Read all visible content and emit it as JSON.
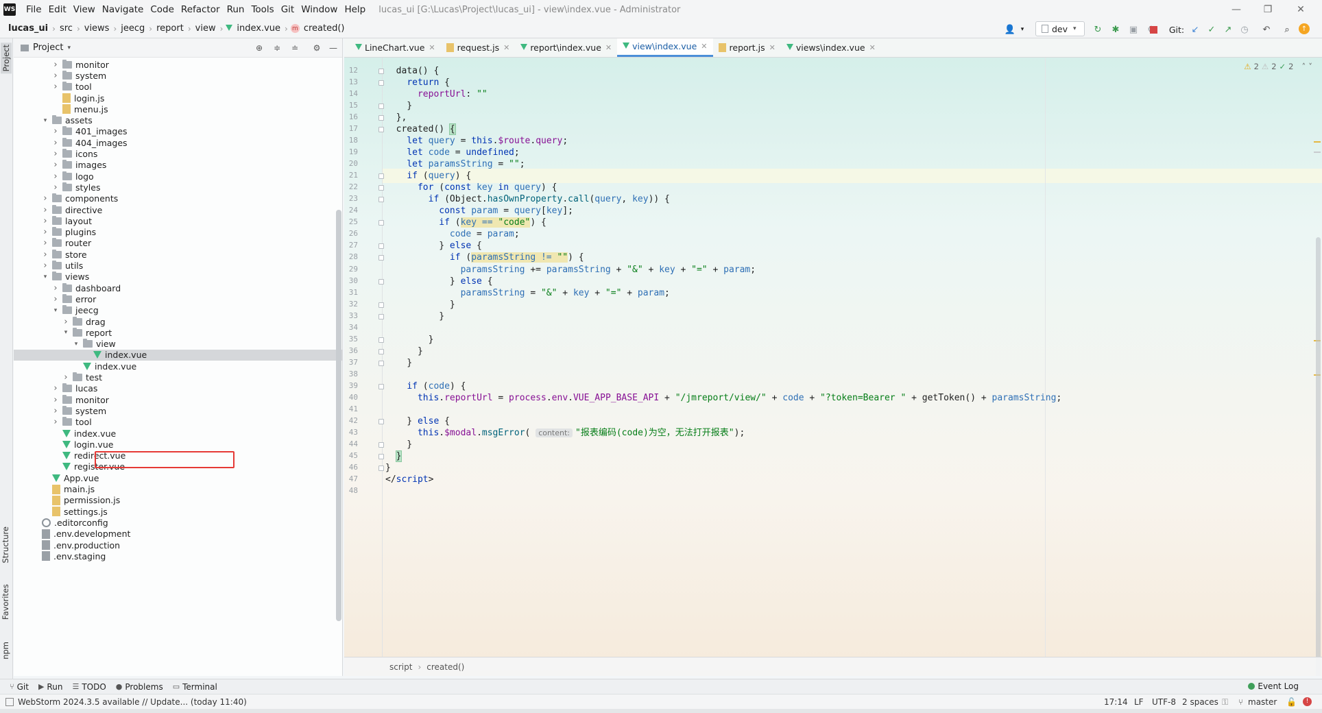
{
  "app": {
    "logo_text": "WS",
    "menu": [
      "File",
      "Edit",
      "View",
      "Navigate",
      "Code",
      "Refactor",
      "Run",
      "Tools",
      "Git",
      "Window",
      "Help"
    ],
    "window_title": "lucas_ui [G:\\Lucas\\Project\\lucas_ui] - view\\index.vue - Administrator"
  },
  "navbar": {
    "crumbs": [
      "lucas_ui",
      "src",
      "views",
      "jeecg",
      "report",
      "view",
      "index.vue",
      "created()"
    ],
    "branch": "dev",
    "git_label": "Git:"
  },
  "left_strip": {
    "project": "Project",
    "structure": "Structure",
    "favorites": "Favorites",
    "npm": "npm"
  },
  "project_panel": {
    "title": "Project",
    "tree": [
      {
        "label": "monitor",
        "type": "folder",
        "depth": 3,
        "expanded": false
      },
      {
        "label": "system",
        "type": "folder",
        "depth": 3,
        "expanded": false
      },
      {
        "label": "tool",
        "type": "folder",
        "depth": 3,
        "expanded": false
      },
      {
        "label": "login.js",
        "type": "js",
        "depth": 3
      },
      {
        "label": "menu.js",
        "type": "js",
        "depth": 3
      },
      {
        "label": "assets",
        "type": "folder",
        "depth": 2,
        "expanded": true
      },
      {
        "label": "401_images",
        "type": "folder",
        "depth": 3,
        "expanded": false
      },
      {
        "label": "404_images",
        "type": "folder",
        "depth": 3,
        "expanded": false
      },
      {
        "label": "icons",
        "type": "folder",
        "depth": 3,
        "expanded": false
      },
      {
        "label": "images",
        "type": "folder",
        "depth": 3,
        "expanded": false
      },
      {
        "label": "logo",
        "type": "folder",
        "depth": 3,
        "expanded": false
      },
      {
        "label": "styles",
        "type": "folder",
        "depth": 3,
        "expanded": false
      },
      {
        "label": "components",
        "type": "folder",
        "depth": 2,
        "expanded": false
      },
      {
        "label": "directive",
        "type": "folder",
        "depth": 2,
        "expanded": false
      },
      {
        "label": "layout",
        "type": "folder",
        "depth": 2,
        "expanded": false
      },
      {
        "label": "plugins",
        "type": "folder",
        "depth": 2,
        "expanded": false
      },
      {
        "label": "router",
        "type": "folder",
        "depth": 2,
        "expanded": false
      },
      {
        "label": "store",
        "type": "folder",
        "depth": 2,
        "expanded": false
      },
      {
        "label": "utils",
        "type": "folder",
        "depth": 2,
        "expanded": false
      },
      {
        "label": "views",
        "type": "folder",
        "depth": 2,
        "expanded": true
      },
      {
        "label": "dashboard",
        "type": "folder",
        "depth": 3,
        "expanded": false
      },
      {
        "label": "error",
        "type": "folder",
        "depth": 3,
        "expanded": false
      },
      {
        "label": "jeecg",
        "type": "folder",
        "depth": 3,
        "expanded": true
      },
      {
        "label": "drag",
        "type": "folder",
        "depth": 4,
        "expanded": false
      },
      {
        "label": "report",
        "type": "folder",
        "depth": 4,
        "expanded": true
      },
      {
        "label": "view",
        "type": "folder",
        "depth": 5,
        "expanded": true
      },
      {
        "label": "index.vue",
        "type": "vue",
        "depth": 6,
        "selected": true
      },
      {
        "label": "index.vue",
        "type": "vue",
        "depth": 5
      },
      {
        "label": "test",
        "type": "folder",
        "depth": 4,
        "expanded": false
      },
      {
        "label": "lucas",
        "type": "folder",
        "depth": 3,
        "expanded": false
      },
      {
        "label": "monitor",
        "type": "folder",
        "depth": 3,
        "expanded": false
      },
      {
        "label": "system",
        "type": "folder",
        "depth": 3,
        "expanded": false
      },
      {
        "label": "tool",
        "type": "folder",
        "depth": 3,
        "expanded": false
      },
      {
        "label": "index.vue",
        "type": "vue",
        "depth": 3
      },
      {
        "label": "login.vue",
        "type": "vue",
        "depth": 3
      },
      {
        "label": "redirect.vue",
        "type": "vue",
        "depth": 3
      },
      {
        "label": "register.vue",
        "type": "vue",
        "depth": 3
      },
      {
        "label": "App.vue",
        "type": "vue",
        "depth": 2
      },
      {
        "label": "main.js",
        "type": "js",
        "depth": 2
      },
      {
        "label": "permission.js",
        "type": "js",
        "depth": 2
      },
      {
        "label": "settings.js",
        "type": "js",
        "depth": 2
      },
      {
        "label": ".editorconfig",
        "type": "gear",
        "depth": 1
      },
      {
        "label": ".env.development",
        "type": "cfg",
        "depth": 1
      },
      {
        "label": ".env.production",
        "type": "cfg",
        "depth": 1
      },
      {
        "label": ".env.staging",
        "type": "cfg",
        "depth": 1
      }
    ]
  },
  "editor": {
    "tabs": [
      {
        "label": "LineChart.vue",
        "icon": "vue",
        "active": false
      },
      {
        "label": "request.js",
        "icon": "js",
        "active": false
      },
      {
        "label": "report\\index.vue",
        "icon": "vue",
        "active": false
      },
      {
        "label": "view\\index.vue",
        "icon": "vue",
        "active": true
      },
      {
        "label": "report.js",
        "icon": "js",
        "active": false
      },
      {
        "label": "views\\index.vue",
        "icon": "vue",
        "active": false
      }
    ],
    "inspections": {
      "warnings": "2",
      "weak": "2",
      "ok": "2"
    },
    "first_line_number": 12,
    "current_line": 17,
    "lines": [
      [
        [
          "  data() {",
          ""
        ]
      ],
      [
        [
          "    ",
          ""
        ],
        [
          "return",
          "kw"
        ],
        [
          " {",
          ""
        ]
      ],
      [
        [
          "      ",
          ""
        ],
        [
          "reportUrl",
          "prop"
        ],
        [
          ": ",
          ""
        ],
        [
          "\"\"",
          "str"
        ]
      ],
      [
        [
          "    }",
          ""
        ]
      ],
      [
        [
          "  },",
          ""
        ]
      ],
      [
        [
          "  created() ",
          ""
        ],
        [
          "{",
          "brace"
        ]
      ],
      [
        [
          "    ",
          ""
        ],
        [
          "let",
          "kw"
        ],
        [
          " ",
          ""
        ],
        [
          "query",
          "var"
        ],
        [
          " = ",
          ""
        ],
        [
          "this",
          "kw"
        ],
        [
          ".",
          ""
        ],
        [
          "$route",
          "prop"
        ],
        [
          ".",
          ""
        ],
        [
          "query",
          "prop"
        ],
        [
          ";",
          ""
        ]
      ],
      [
        [
          "    ",
          ""
        ],
        [
          "let",
          "kw"
        ],
        [
          " ",
          ""
        ],
        [
          "code",
          "var"
        ],
        [
          " = ",
          ""
        ],
        [
          "undefined",
          "kw"
        ],
        [
          ";",
          ""
        ]
      ],
      [
        [
          "    ",
          ""
        ],
        [
          "let",
          "kw"
        ],
        [
          " ",
          ""
        ],
        [
          "paramsString",
          "var"
        ],
        [
          " = ",
          ""
        ],
        [
          "\"\"",
          "str"
        ],
        [
          ";",
          ""
        ]
      ],
      [
        [
          "    ",
          ""
        ],
        [
          "if",
          "kw"
        ],
        [
          " (",
          ""
        ],
        [
          "query",
          "var"
        ],
        [
          ") {",
          ""
        ]
      ],
      [
        [
          "      ",
          ""
        ],
        [
          "for",
          "kw"
        ],
        [
          " (",
          ""
        ],
        [
          "const",
          "kw"
        ],
        [
          " ",
          ""
        ],
        [
          "key",
          "var"
        ],
        [
          " ",
          ""
        ],
        [
          "in",
          "kw"
        ],
        [
          " ",
          ""
        ],
        [
          "query",
          "var"
        ],
        [
          ") {",
          ""
        ]
      ],
      [
        [
          "        ",
          ""
        ],
        [
          "if",
          "kw"
        ],
        [
          " (Object.",
          ""
        ],
        [
          "hasOwnProperty",
          "fn"
        ],
        [
          ".",
          ""
        ],
        [
          "call",
          "fn"
        ],
        [
          "(",
          ""
        ],
        [
          "query",
          "var"
        ],
        [
          ", ",
          ""
        ],
        [
          "key",
          "var"
        ],
        [
          ")) {",
          ""
        ]
      ],
      [
        [
          "          ",
          ""
        ],
        [
          "const",
          "kw"
        ],
        [
          " ",
          ""
        ],
        [
          "param",
          "var"
        ],
        [
          " = ",
          ""
        ],
        [
          "query",
          "var"
        ],
        [
          "[",
          ""
        ],
        [
          "key",
          "var"
        ],
        [
          "];",
          ""
        ]
      ],
      [
        [
          "          ",
          ""
        ],
        [
          "if",
          "kw"
        ],
        [
          " (",
          ""
        ],
        [
          "key == ",
          "hlvar"
        ],
        [
          "\"code\"",
          "hlstr"
        ],
        [
          ") {",
          ""
        ]
      ],
      [
        [
          "            ",
          ""
        ],
        [
          "code",
          "var"
        ],
        [
          " = ",
          ""
        ],
        [
          "param",
          "var"
        ],
        [
          ";",
          ""
        ]
      ],
      [
        [
          "          } ",
          ""
        ],
        [
          "else",
          "kw"
        ],
        [
          " {",
          ""
        ]
      ],
      [
        [
          "            ",
          ""
        ],
        [
          "if",
          "kw"
        ],
        [
          " (",
          ""
        ],
        [
          "paramsString != ",
          "hlvar"
        ],
        [
          "\"\"",
          "hlstr"
        ],
        [
          ") {",
          ""
        ]
      ],
      [
        [
          "              ",
          ""
        ],
        [
          "paramsString",
          "var"
        ],
        [
          " += ",
          ""
        ],
        [
          "paramsString",
          "var"
        ],
        [
          " + ",
          ""
        ],
        [
          "\"&\"",
          "str"
        ],
        [
          " + ",
          ""
        ],
        [
          "key",
          "var"
        ],
        [
          " + ",
          ""
        ],
        [
          "\"=\"",
          "str"
        ],
        [
          " + ",
          ""
        ],
        [
          "param",
          "var"
        ],
        [
          ";",
          ""
        ]
      ],
      [
        [
          "            } ",
          ""
        ],
        [
          "else",
          "kw"
        ],
        [
          " {",
          ""
        ]
      ],
      [
        [
          "              ",
          ""
        ],
        [
          "paramsString",
          "var"
        ],
        [
          " = ",
          ""
        ],
        [
          "\"&\"",
          "str"
        ],
        [
          " + ",
          ""
        ],
        [
          "key",
          "var"
        ],
        [
          " + ",
          ""
        ],
        [
          "\"=\"",
          "str"
        ],
        [
          " + ",
          ""
        ],
        [
          "param",
          "var"
        ],
        [
          ";",
          ""
        ]
      ],
      [
        [
          "            }",
          ""
        ]
      ],
      [
        [
          "          }",
          ""
        ]
      ],
      [
        [
          "",
          ""
        ]
      ],
      [
        [
          "        }",
          ""
        ]
      ],
      [
        [
          "      }",
          ""
        ]
      ],
      [
        [
          "    }",
          ""
        ]
      ],
      [
        [
          "",
          ""
        ]
      ],
      [
        [
          "    ",
          ""
        ],
        [
          "if",
          "kw"
        ],
        [
          " (",
          ""
        ],
        [
          "code",
          "var"
        ],
        [
          ") {",
          ""
        ]
      ],
      [
        [
          "      ",
          ""
        ],
        [
          "this",
          "kw"
        ],
        [
          ".",
          ""
        ],
        [
          "reportUrl",
          "prop"
        ],
        [
          " = ",
          ""
        ],
        [
          "process",
          "prop"
        ],
        [
          ".",
          ""
        ],
        [
          "env",
          "prop"
        ],
        [
          ".",
          ""
        ],
        [
          "VUE_APP_BASE_API",
          "prop"
        ],
        [
          " + ",
          ""
        ],
        [
          "\"/jmreport/view/\"",
          "str"
        ],
        [
          " + ",
          ""
        ],
        [
          "code",
          "var"
        ],
        [
          " + ",
          ""
        ],
        [
          "\"?token=Bearer \"",
          "str"
        ],
        [
          " + getToken() + ",
          ""
        ],
        [
          "paramsString",
          "var"
        ],
        [
          ";",
          ""
        ]
      ],
      [
        [
          "",
          ""
        ]
      ],
      [
        [
          "    } ",
          ""
        ],
        [
          "else",
          "kw"
        ],
        [
          " {",
          ""
        ]
      ],
      [
        [
          "      ",
          ""
        ],
        [
          "this",
          "kw"
        ],
        [
          ".",
          ""
        ],
        [
          "$modal",
          "prop"
        ],
        [
          ".",
          ""
        ],
        [
          "msgError",
          "fn"
        ],
        [
          "( ",
          ""
        ],
        [
          "content:",
          "hint"
        ],
        [
          "\"报表编码(code)为空，无法打开报表\"",
          "str"
        ],
        [
          ");",
          ""
        ]
      ],
      [
        [
          "    }",
          ""
        ]
      ],
      [
        [
          "  ",
          ""
        ],
        [
          "}",
          "brace"
        ]
      ],
      [
        [
          "}",
          ""
        ]
      ],
      [
        [
          "</",
          ""
        ],
        [
          "script",
          "kw"
        ],
        [
          ">",
          ""
        ]
      ],
      [
        [
          "",
          ""
        ]
      ]
    ],
    "breadcrumb": [
      "script",
      "created()"
    ]
  },
  "toolwindows": [
    {
      "label": "Git",
      "icon": "git-icon",
      "glyph": "⑂"
    },
    {
      "label": "Run",
      "icon": "run-icon",
      "glyph": "▶"
    },
    {
      "label": "TODO",
      "icon": "todo-icon",
      "glyph": "☰"
    },
    {
      "label": "Problems",
      "icon": "problems-icon",
      "glyph": "●"
    },
    {
      "label": "Terminal",
      "icon": "terminal-icon",
      "glyph": "▭"
    }
  ],
  "event_log": "Event Log",
  "status": {
    "message": "WebStorm 2024.3.5 available // Update... (today 11:40)",
    "position": "17:14",
    "line_sep": "LF",
    "encoding": "UTF-8",
    "indent": "2 spaces",
    "branch": "master"
  }
}
